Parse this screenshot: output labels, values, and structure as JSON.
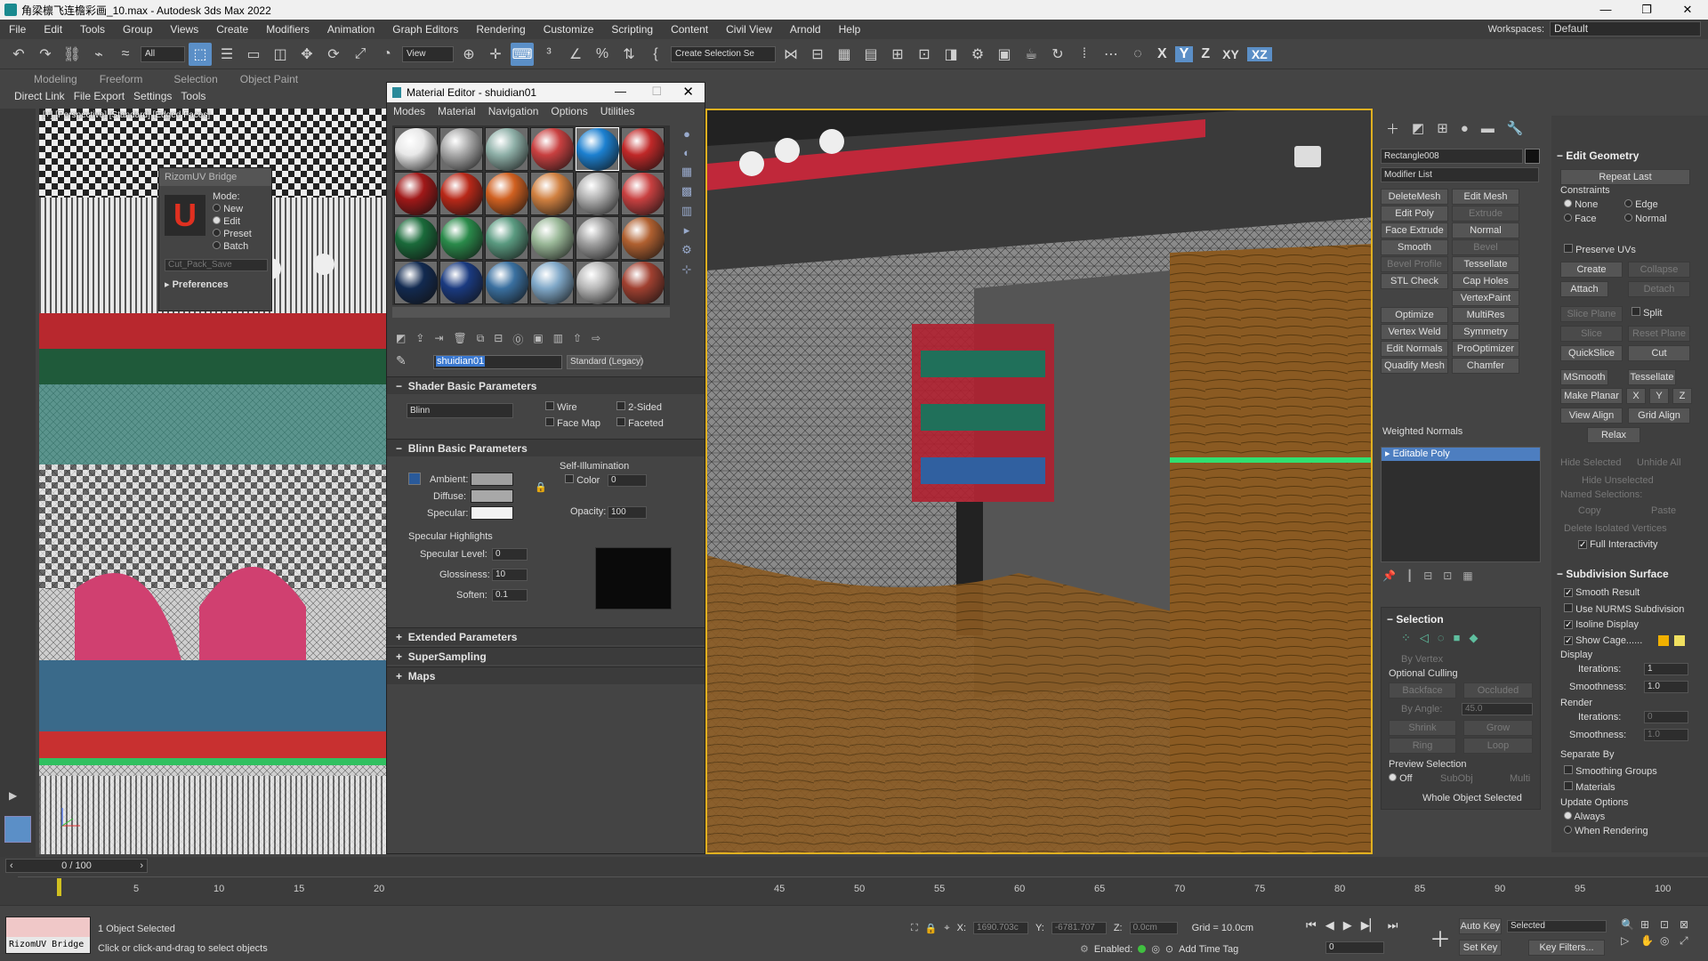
{
  "window": {
    "title": "角梁檩飞连檐彩画_10.max - Autodesk 3ds Max 2022",
    "minimize": "—",
    "restore": "❐",
    "close": "✕"
  },
  "menu": [
    "File",
    "Edit",
    "Tools",
    "Group",
    "Views",
    "Create",
    "Modifiers",
    "Animation",
    "Graph Editors",
    "Rendering",
    "Customize",
    "Scripting",
    "Content",
    "Civil View",
    "Arnold",
    "Help"
  ],
  "workspace": {
    "label": "Workspaces:",
    "value": "Default"
  },
  "toolbar": {
    "filter": "All",
    "refcoord": "View",
    "selset": "Create Selection Se",
    "axes": [
      "X",
      "Y",
      "Z",
      "XY",
      "XZ"
    ]
  },
  "ribbon": {
    "tabs": [
      "Modeling",
      "Freeform",
      "Selection",
      "Object Paint"
    ],
    "row2": [
      "Direct Link",
      "File Export",
      "Settings",
      "Tools"
    ]
  },
  "viewport_left": {
    "label": "[+] [Perspective] [Standard] [Edged Faces]"
  },
  "rizom": {
    "title": "RizomUV Bridge",
    "mode_label": "Mode:",
    "modes": [
      "New",
      "Edit",
      "Preset",
      "Batch"
    ],
    "selected_mode": "Edit",
    "dropdown": "Cut_Pack_Save",
    "prefs": "Preferences"
  },
  "material_editor": {
    "title": "Material Editor - shuidian01",
    "menu": [
      "Modes",
      "Material",
      "Navigation",
      "Options",
      "Utilities"
    ],
    "material_name": "shuidian01",
    "material_type": "Standard (Legacy)",
    "shader_rollout": "Shader Basic Parameters",
    "shader": "Blinn",
    "checks": [
      "Wire",
      "2-Sided",
      "Face Map",
      "Faceted"
    ],
    "blinn_rollout": "Blinn Basic Parameters",
    "self_illum": "Self-Illumination",
    "color_label": "Color",
    "color_value": "0",
    "ambient": "Ambient:",
    "diffuse": "Diffuse:",
    "specular": "Specular:",
    "opacity_label": "Opacity:",
    "opacity_value": "100",
    "spec_highlights": "Specular Highlights",
    "spec_level_label": "Specular Level:",
    "spec_level": "0",
    "glossiness_label": "Glossiness:",
    "glossiness": "10",
    "soften_label": "Soften:",
    "soften": "0.1",
    "extended": "Extended Parameters",
    "supersampling": "SuperSampling",
    "maps": "Maps",
    "slot_colors": [
      [
        "#e8e8e8",
        "#a8a8a8",
        "#8fb0a8",
        "#c84040",
        "#1c80d0",
        "#c02828"
      ],
      [
        "#a01818",
        "#b82818",
        "#d06020",
        "#d08040",
        "#b0b0b0",
        "#c84040"
      ],
      [
        "#1a6a3a",
        "#2a8a4a",
        "#5a9a80",
        "#9ab898",
        "#a0a0a0",
        "#b06030"
      ],
      [
        "#122a50",
        "#1a3a80",
        "#3a70a0",
        "#80a8c8",
        "#b8b8b8",
        "#a04030"
      ]
    ]
  },
  "command_panel": {
    "object_name": "Rectangle008",
    "modifier_list": "Modifier List",
    "mod_buttons": [
      [
        "DeleteMesh",
        "Edit Mesh"
      ],
      [
        "Edit Poly",
        "Extrude"
      ],
      [
        "Face Extrude",
        "Normal"
      ],
      [
        "Smooth",
        "Bevel"
      ],
      [
        "Bevel Profile",
        "Tessellate"
      ],
      [
        "STL Check",
        "Cap Holes"
      ],
      [
        "",
        "VertexPaint"
      ],
      [
        "Optimize",
        "MultiRes"
      ],
      [
        "Vertex Weld",
        "Symmetry"
      ],
      [
        "Edit Normals",
        "ProOptimizer"
      ],
      [
        "Quadify Mesh",
        "Chamfer"
      ]
    ],
    "weighted_normals": "Weighted Normals",
    "stack_item": "Editable Poly",
    "selection": {
      "title": "Selection",
      "by_vertex": "By Vertex",
      "optional_culling": "Optional Culling",
      "backface": "Backface",
      "occluded": "Occluded",
      "by_angle": "By Angle:",
      "angle": "45.0",
      "shrink": "Shrink",
      "grow": "Grow",
      "ring": "Ring",
      "loop": "Loop",
      "preview": "Preview Selection",
      "off": "Off",
      "subobj": "SubObj",
      "multi": "Multi",
      "status": "Whole Object Selected"
    },
    "edit_geometry": {
      "title": "Edit Geometry",
      "repeat_last": "Repeat Last",
      "constraints": "Constraints",
      "c_none": "None",
      "c_edge": "Edge",
      "c_face": "Face",
      "c_normal": "Normal",
      "preserve_uvs": "Preserve UVs",
      "create": "Create",
      "collapse": "Collapse",
      "attach": "Attach",
      "detach": "Detach",
      "slice_plane": "Slice Plane",
      "split": "Split",
      "slice": "Slice",
      "reset_plane": "Reset Plane",
      "quickslice": "QuickSlice",
      "cut": "Cut",
      "msmooth": "MSmooth",
      "tessellate": "Tessellate",
      "make_planar": "Make Planar",
      "x": "X",
      "y": "Y",
      "z": "Z",
      "view_align": "View Align",
      "grid_align": "Grid Align",
      "relax": "Relax",
      "hide_selected": "Hide Selected",
      "unhide_all": "Unhide All",
      "hide_unselected": "Hide Unselected",
      "named_sel": "Named Selections:",
      "copy": "Copy",
      "paste": "Paste",
      "delete_isolated": "Delete Isolated Vertices",
      "full_interactivity": "Full Interactivity"
    },
    "subdivision": {
      "title": "Subdivision Surface",
      "smooth_result": "Smooth Result",
      "use_nurms": "Use NURMS Subdivision",
      "isoline": "Isoline Display",
      "show_cage": "Show Cage......",
      "display": "Display",
      "iterations": "Iterations:",
      "disp_iter": "1",
      "smoothness": "Smoothness:",
      "disp_smooth": "1.0",
      "render": "Render",
      "rend_iter": "0",
      "rend_smooth": "1.0",
      "separate_by": "Separate By",
      "smoothing_groups": "Smoothing Groups",
      "materials": "Materials",
      "update_options": "Update Options",
      "always": "Always",
      "when_rendering": "When Rendering"
    }
  },
  "timeline": {
    "frame": "0 / 100",
    "ticks": [
      "5",
      "10",
      "15",
      "20",
      "45",
      "50",
      "55",
      "60",
      "65",
      "70",
      "75",
      "80",
      "85",
      "90",
      "95",
      "100"
    ]
  },
  "status": {
    "selected": "1 Object Selected",
    "prompt": "Click or click-and-drag to select objects",
    "script_box": "RizomUV Bridge",
    "x_label": "X:",
    "x_val": "1690.703c",
    "y_label": "Y:",
    "y_val": "-6781.707",
    "z_label": "Z:",
    "z_val": "0.0cm",
    "grid": "Grid = 10.0cm",
    "enabled": "Enabled:",
    "add_time_tag": "Add Time Tag",
    "auto_key": "Auto Key",
    "set_key": "Set Key",
    "selected_dd": "Selected",
    "key_filters": "Key Filters...",
    "frame_field": "0"
  }
}
